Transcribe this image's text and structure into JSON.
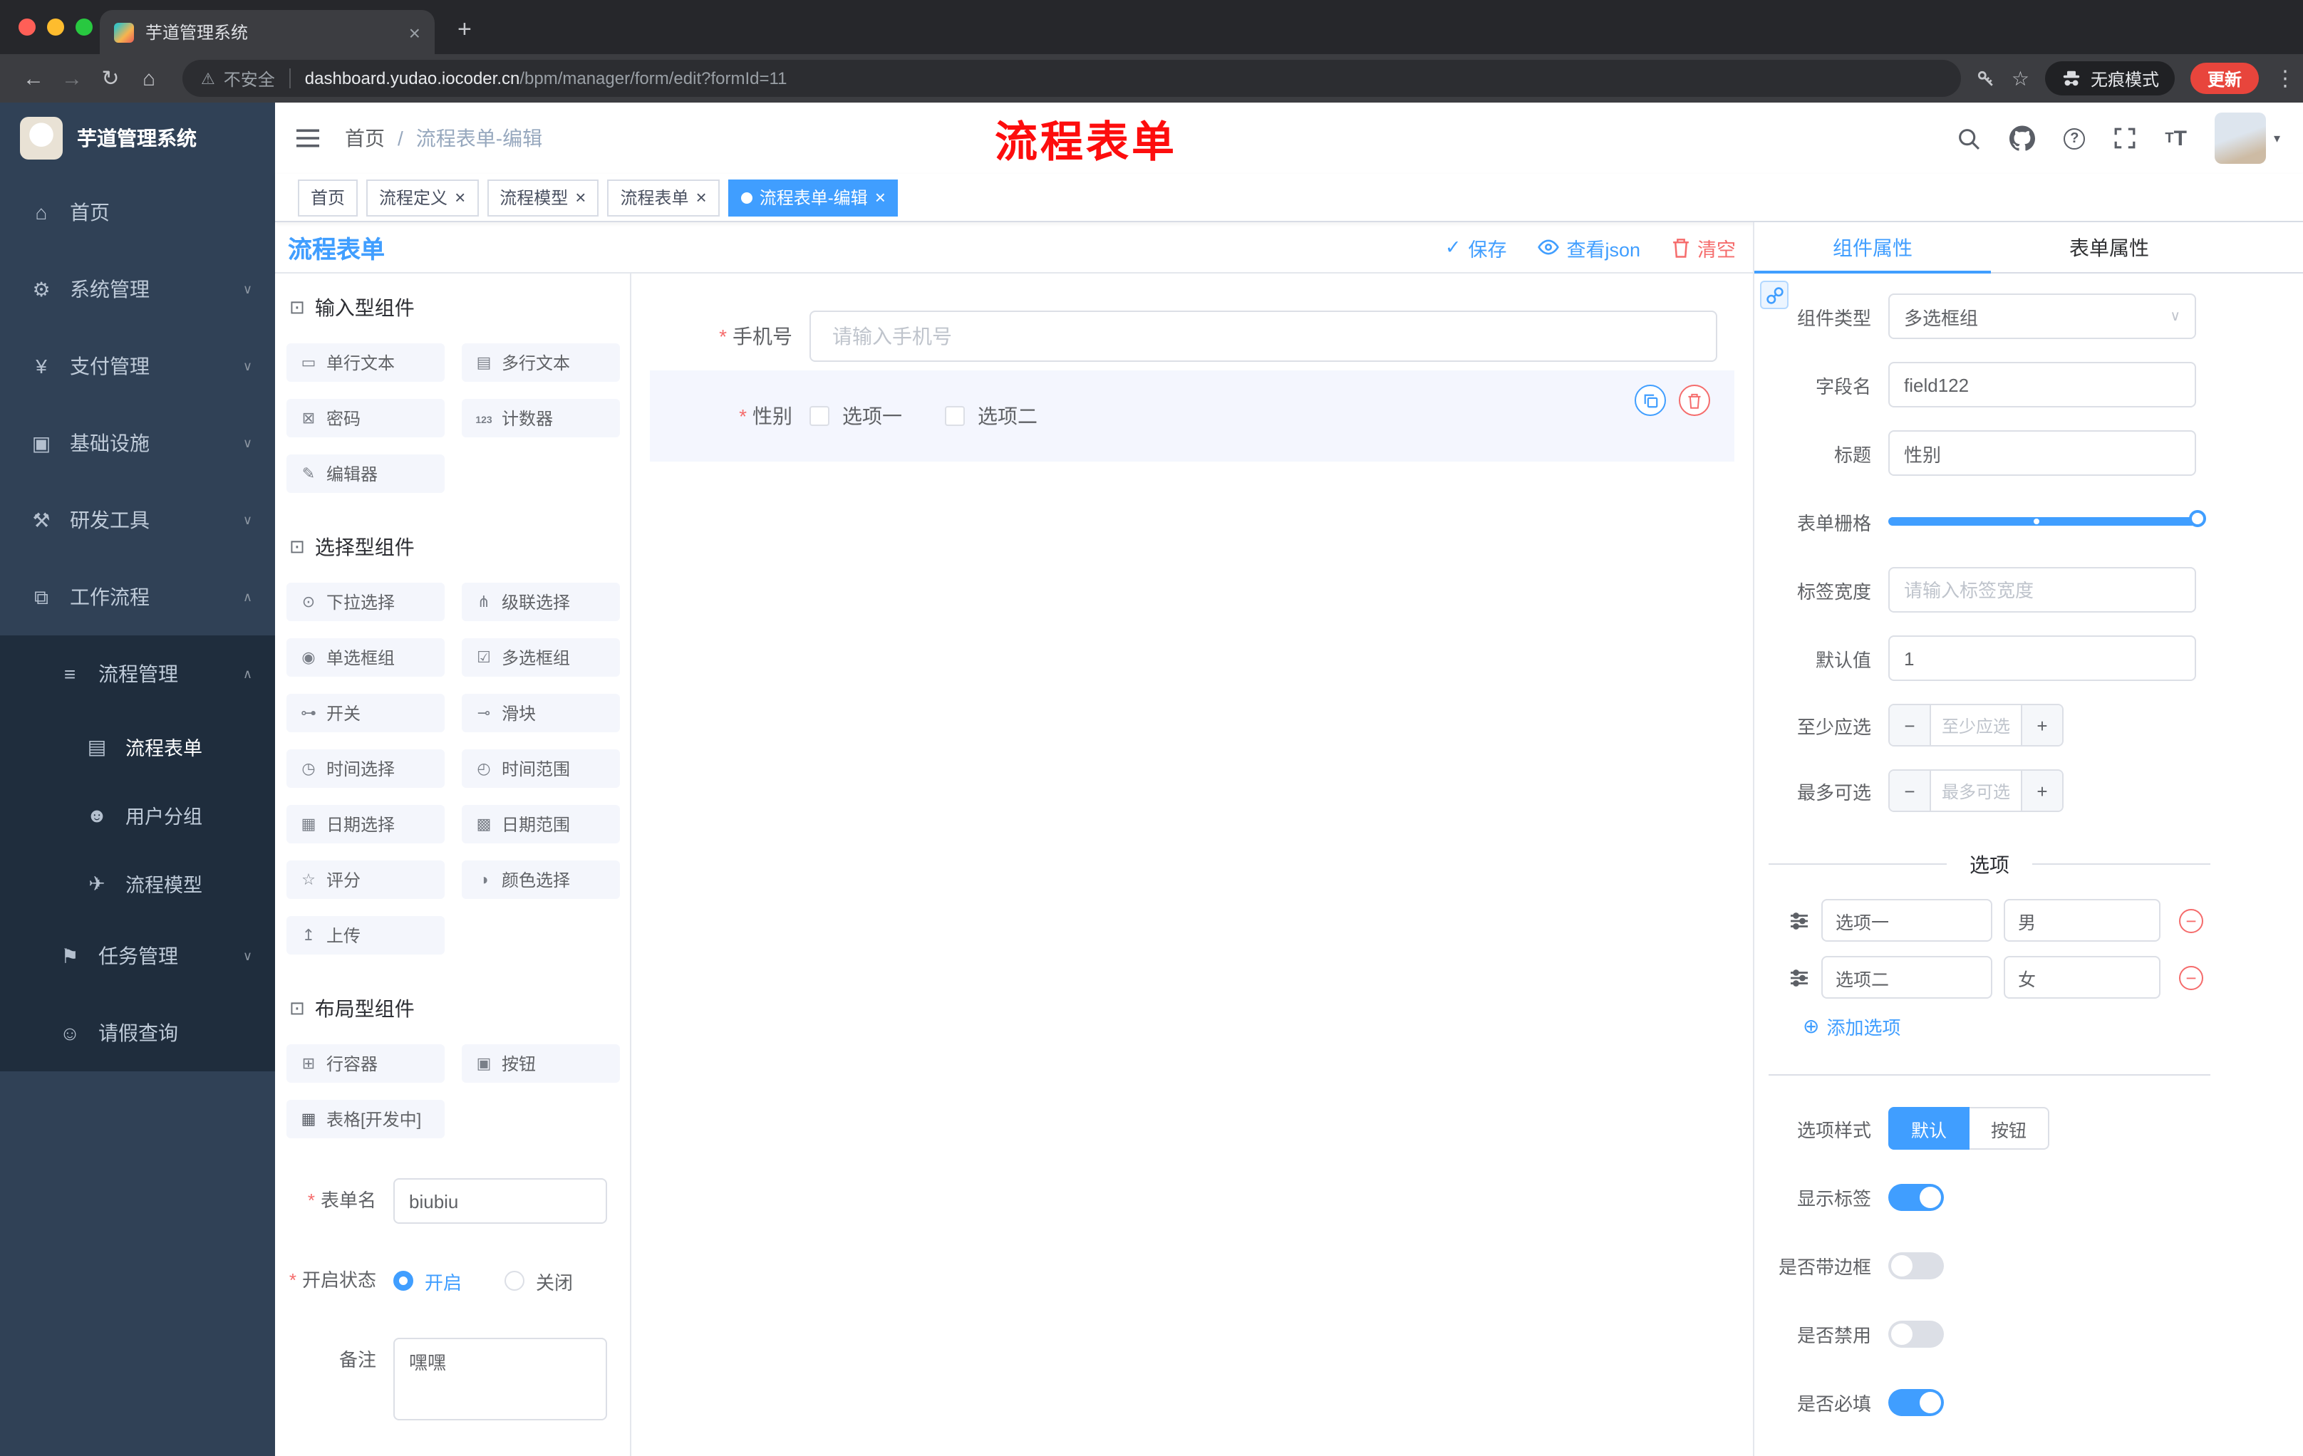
{
  "browser": {
    "tab_title": "芋道管理系统",
    "security_label": "不安全",
    "url_domain": "dashboard.yudao.iocoder.cn",
    "url_path": "/bpm/manager/form/edit?formId=11",
    "incognito_label": "无痕模式",
    "update_label": "更新",
    "icons": [
      "back-icon",
      "forward-icon",
      "reload-icon",
      "home-icon",
      "warning-icon",
      "key-icon",
      "star-icon",
      "incognito-icon",
      "kebab-menu-icon"
    ]
  },
  "sidebar": {
    "logo_title": "芋道管理系统",
    "menu": {
      "home": "首页",
      "system": "系统管理",
      "payment": "支付管理",
      "infra": "基础设施",
      "devtools": "研发工具",
      "workflow": "工作流程",
      "process_manage": "流程管理",
      "process_form": "流程表单",
      "user_group": "用户分组",
      "process_model": "流程模型",
      "task_manage": "任务管理",
      "leave_query": "请假查询"
    }
  },
  "navbar": {
    "breadcrumb_home": "首页",
    "breadcrumb_sep": "/",
    "breadcrumb_current": "流程表单-编辑",
    "annotation": "流程表单",
    "icons": [
      "search-icon",
      "github-icon",
      "help-icon",
      "fullscreen-icon",
      "font-size-icon",
      "avatar"
    ]
  },
  "tags": [
    "首页",
    "流程定义",
    "流程模型",
    "流程表单",
    "流程表单-编辑"
  ],
  "designer": {
    "title": "流程表单",
    "save_label": "保存",
    "view_json_label": "查看json",
    "clear_label": "清空"
  },
  "palette": {
    "sections": [
      {
        "title": "输入型组件",
        "items": [
          {
            "label": "单行文本",
            "icon": "text-input-icon"
          },
          {
            "label": "多行文本",
            "icon": "textarea-icon"
          },
          {
            "label": "密码",
            "icon": "password-icon"
          },
          {
            "label": "计数器",
            "icon": "counter-icon"
          },
          {
            "label": "编辑器",
            "icon": "editor-icon"
          }
        ]
      },
      {
        "title": "选择型组件",
        "items": [
          {
            "label": "下拉选择",
            "icon": "select-icon"
          },
          {
            "label": "级联选择",
            "icon": "cascader-icon"
          },
          {
            "label": "单选框组",
            "icon": "radio-group-icon"
          },
          {
            "label": "多选框组",
            "icon": "checkbox-group-icon"
          },
          {
            "label": "开关",
            "icon": "switch-icon"
          },
          {
            "label": "滑块",
            "icon": "slider-icon"
          },
          {
            "label": "时间选择",
            "icon": "time-picker-icon"
          },
          {
            "label": "时间范围",
            "icon": "time-range-icon"
          },
          {
            "label": "日期选择",
            "icon": "date-picker-icon"
          },
          {
            "label": "日期范围",
            "icon": "date-range-icon"
          },
          {
            "label": "评分",
            "icon": "rate-icon"
          },
          {
            "label": "颜色选择",
            "icon": "color-picker-icon"
          },
          {
            "label": "上传",
            "icon": "upload-icon"
          }
        ]
      },
      {
        "title": "布局型组件",
        "items": [
          {
            "label": "行容器",
            "icon": "row-container-icon"
          },
          {
            "label": "按钮",
            "icon": "button-icon"
          },
          {
            "label": "表格[开发中]",
            "icon": "table-icon"
          }
        ]
      }
    ]
  },
  "form_meta": {
    "name_label": "表单名",
    "name_value": "biubiu",
    "status_label": "开启状态",
    "status_on": "开启",
    "status_off": "关闭",
    "status_selected": "开启",
    "remark_label": "备注",
    "remark_value": "嘿嘿"
  },
  "canvas": {
    "phone_label": "手机号",
    "phone_placeholder": "请输入手机号",
    "gender_label": "性别",
    "gender_options": [
      "选项一",
      "选项二"
    ]
  },
  "props": {
    "tab_component": "组件属性",
    "tab_form": "表单属性",
    "type_label": "组件类型",
    "type_value": "多选框组",
    "field_label": "字段名",
    "field_value": "field122",
    "title_label": "标题",
    "title_value": "性别",
    "grid_label": "表单栅格",
    "width_label": "标签宽度",
    "width_placeholder": "请输入标签宽度",
    "default_label": "默认值",
    "default_value": "1",
    "min_label": "至少应选",
    "min_placeholder": "至少应选",
    "max_label": "最多可选",
    "max_placeholder": "最多可选",
    "options_title": "选项",
    "options": [
      {
        "label": "选项一",
        "value": "男"
      },
      {
        "label": "选项二",
        "value": "女"
      }
    ],
    "add_option_label": "添加选项",
    "style_label": "选项样式",
    "style_default": "默认",
    "style_button": "按钮",
    "toggle_show_label": "显示标签",
    "toggle_border": "是否带边框",
    "toggle_disabled": "是否禁用",
    "toggle_required": "是否必填",
    "accent_color": "#409eff",
    "danger_color": "#f56c6c"
  }
}
